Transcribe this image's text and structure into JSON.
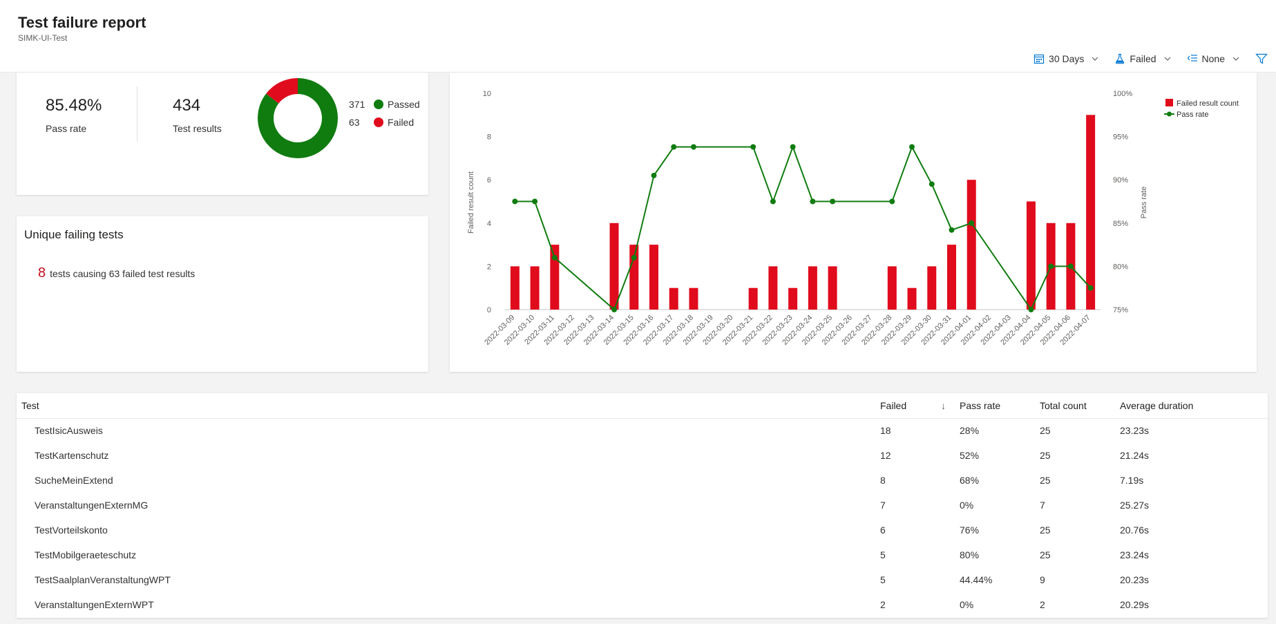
{
  "header": {
    "title": "Test failure report",
    "subtitle": "SIMK-UI-Test"
  },
  "toolbar": {
    "days_label": "30 Days",
    "outcome_label": "Failed",
    "group_label": "None"
  },
  "summary": {
    "pass_rate_value": "85.48%",
    "pass_rate_label": "Pass rate",
    "results_value": "434",
    "results_label": "Test results",
    "passed_count": "371",
    "passed_label": "Passed",
    "failed_count": "63",
    "failed_label": "Failed",
    "passed_color": "#107c10",
    "failed_color": "#e00b1c"
  },
  "unique": {
    "title": "Unique failing tests",
    "count": "8",
    "text": "tests causing 63 failed test results"
  },
  "chart_data": {
    "type": "bar",
    "categories": [
      "2022-03-09",
      "2022-03-10",
      "2022-03-11",
      "2022-03-12",
      "2022-03-13",
      "2022-03-14",
      "2022-03-15",
      "2022-03-16",
      "2022-03-17",
      "2022-03-18",
      "2022-03-19",
      "2022-03-20",
      "2022-03-21",
      "2022-03-22",
      "2022-03-23",
      "2022-03-24",
      "2022-03-25",
      "2022-03-26",
      "2022-03-27",
      "2022-03-28",
      "2022-03-29",
      "2022-03-30",
      "2022-03-31",
      "2022-04-01",
      "2022-04-02",
      "2022-04-03",
      "2022-04-04",
      "2022-04-05",
      "2022-04-06",
      "2022-04-07"
    ],
    "series": [
      {
        "name": "Failed result count",
        "type": "bar",
        "color": "#e00b1c",
        "values": [
          2,
          2,
          3,
          0,
          0,
          4,
          3,
          3,
          1,
          1,
          0,
          0,
          1,
          2,
          1,
          2,
          2,
          0,
          0,
          2,
          1,
          2,
          3,
          6,
          0,
          0,
          5,
          4,
          4,
          9
        ]
      },
      {
        "name": "Pass rate",
        "type": "line",
        "color": "#107c10",
        "values": [
          87.5,
          87.5,
          81,
          null,
          null,
          75,
          81,
          90.5,
          93.8,
          93.8,
          null,
          null,
          93.8,
          87.5,
          93.8,
          87.5,
          87.5,
          null,
          null,
          87.5,
          93.8,
          89.5,
          84.2,
          85,
          null,
          null,
          75,
          80,
          80,
          77.5
        ]
      }
    ],
    "ylabel": "Failed result count",
    "y2label": "Pass rate",
    "ylim": [
      0,
      10
    ],
    "yticks": [
      "0",
      "2",
      "4",
      "6",
      "8",
      "10"
    ],
    "y2lim": [
      75,
      100
    ],
    "y2ticks": [
      "75%",
      "80%",
      "85%",
      "90%",
      "95%",
      "100%"
    ],
    "legend": "top-right"
  },
  "table": {
    "headers": {
      "test": "Test",
      "failed": "Failed",
      "pass_rate": "Pass rate",
      "total": "Total count",
      "avg": "Average duration"
    },
    "sort_icon": "↓",
    "rows": [
      {
        "test": "TestIsicAusweis",
        "failed": "18",
        "pass_rate": "28%",
        "total": "25",
        "avg": "23.23s"
      },
      {
        "test": "TestKartenschutz",
        "failed": "12",
        "pass_rate": "52%",
        "total": "25",
        "avg": "21.24s"
      },
      {
        "test": "SucheMeinExtend",
        "failed": "8",
        "pass_rate": "68%",
        "total": "25",
        "avg": "7.19s"
      },
      {
        "test": "VeranstaltungenExternMG",
        "failed": "7",
        "pass_rate": "0%",
        "total": "7",
        "avg": "25.27s"
      },
      {
        "test": "TestVorteilskonto",
        "failed": "6",
        "pass_rate": "76%",
        "total": "25",
        "avg": "20.76s"
      },
      {
        "test": "TestMobilgeraeteschutz",
        "failed": "5",
        "pass_rate": "80%",
        "total": "25",
        "avg": "23.24s"
      },
      {
        "test": "TestSaalplanVeranstaltungWPT",
        "failed": "5",
        "pass_rate": "44.44%",
        "total": "9",
        "avg": "20.23s"
      },
      {
        "test": "VeranstaltungenExternWPT",
        "failed": "2",
        "pass_rate": "0%",
        "total": "2",
        "avg": "20.29s"
      }
    ]
  }
}
